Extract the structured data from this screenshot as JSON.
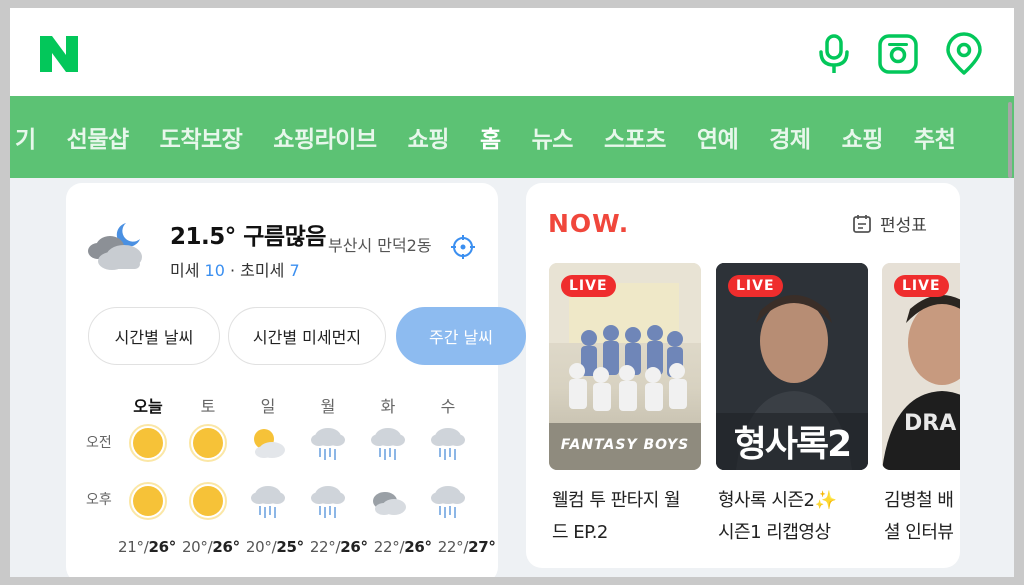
{
  "brand": {
    "logo_letter": "N",
    "accent": "#03c75a"
  },
  "top_icons": [
    "microphone-icon",
    "lens-camera-icon",
    "location-pin-icon"
  ],
  "nav": {
    "items": [
      "기",
      "선물샵",
      "도착보장",
      "쇼핑라이브",
      "쇼핑",
      "홈",
      "뉴스",
      "스포츠",
      "연예",
      "경제",
      "쇼핑",
      "추천"
    ],
    "active": "홈"
  },
  "weather": {
    "temp_condition": "21.5° 구름많음",
    "location": "부산시 만덕2동",
    "dust_label": "미세",
    "dust_value": "10",
    "fine_dust_label": "· 초미세",
    "fine_dust_value": "7",
    "tabs": [
      "시간별 날씨",
      "시간별 미세먼지",
      "주간 날씨"
    ],
    "active_tab": "주간 날씨",
    "days": [
      "오늘",
      "토",
      "일",
      "월",
      "화",
      "수"
    ],
    "am_label": "오전",
    "pm_label": "오후",
    "am_icons": [
      "sun-icon",
      "sun-icon",
      "partly-cloudy-icon",
      "rain-icon",
      "rain-icon",
      "rain-icon"
    ],
    "pm_icons": [
      "sun-icon",
      "sun-icon",
      "rain-icon",
      "rain-icon",
      "cloudy-icon",
      "rain-icon"
    ],
    "temps": [
      {
        "low": "21°",
        "high": "26°"
      },
      {
        "low": "20°",
        "high": "26°"
      },
      {
        "low": "20°",
        "high": "25°"
      },
      {
        "low": "22°",
        "high": "26°"
      },
      {
        "low": "22°",
        "high": "26°"
      },
      {
        "low": "22°",
        "high": "27°"
      }
    ]
  },
  "now": {
    "logo": "NOW.",
    "schedule_label": "편성표",
    "live_badge": "LIVE",
    "items": [
      {
        "line1": "웰컴 투 판타지 월",
        "line2": "드 EP.2",
        "thumb_text": "FANTASY BOYS"
      },
      {
        "line1": "형사록 시즌2✨",
        "line2": "시즌1 리캡영상",
        "thumb_text": "형사록2"
      },
      {
        "line1": "김병철 배",
        "line2": "셜 인터뷰",
        "thumb_text": "DRA"
      }
    ]
  }
}
